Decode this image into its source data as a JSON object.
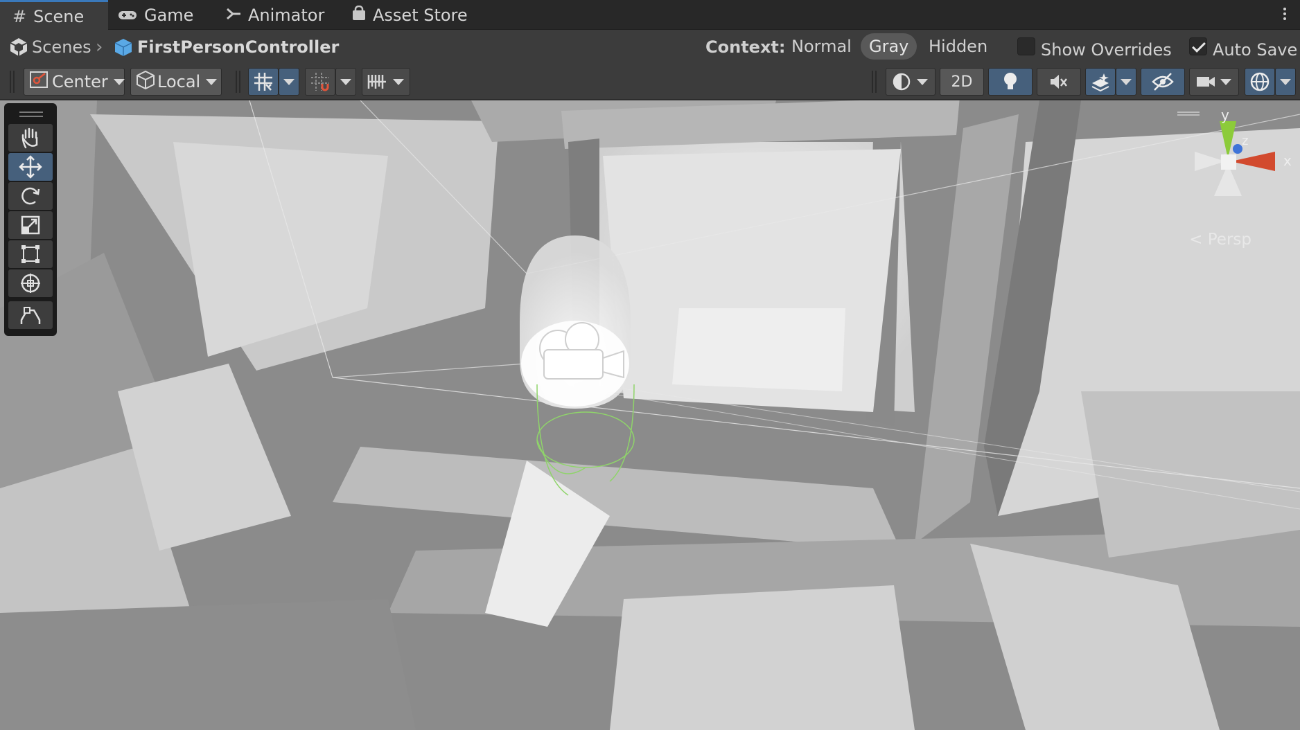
{
  "tabs": [
    {
      "label": "Scene",
      "icon": "scene-grid-icon",
      "active": true
    },
    {
      "label": "Game",
      "icon": "gamepad-icon",
      "active": false
    },
    {
      "label": "Animator",
      "icon": "animator-icon",
      "active": false
    },
    {
      "label": "Asset Store",
      "icon": "shopping-bag-icon",
      "active": false
    }
  ],
  "breadcrumb": {
    "root": "Scenes",
    "current": "FirstPersonController"
  },
  "context": {
    "label": "Context:",
    "options": [
      "Normal",
      "Gray",
      "Hidden"
    ],
    "selected": "Gray"
  },
  "show_overrides": {
    "label": "Show Overrides",
    "checked": false
  },
  "auto_save": {
    "label": "Auto Save",
    "checked": true
  },
  "toolbar": {
    "pivot_label": "Center",
    "space_label": "Local",
    "mode_2d_label": "2D"
  },
  "gizmo": {
    "y_label": "y",
    "z_label": "z",
    "x_label": "x",
    "persp_label": "< Persp"
  },
  "colors": {
    "accent": "#3a79bb",
    "selected_tool": "#46607c",
    "collider": "#8fd46a",
    "axis_x": "#d24a2e",
    "axis_y": "#8ccb3a",
    "axis_z": "#3f74d8"
  }
}
